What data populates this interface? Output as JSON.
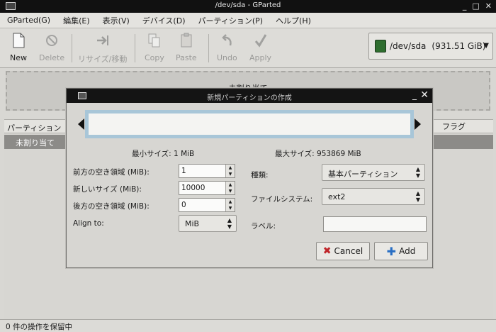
{
  "window": {
    "title": "/dev/sda - GParted",
    "controls": [
      "_",
      "□",
      "✕"
    ]
  },
  "menubar": {
    "items": [
      "GParted(G)",
      "編集(E)",
      "表示(V)",
      "デバイス(D)",
      "パーティション(P)",
      "ヘルプ(H)"
    ]
  },
  "toolbar": {
    "new": "New",
    "delete": "Delete",
    "resize": "リサイズ/移動",
    "copy": "Copy",
    "paste": "Paste",
    "undo": "Undo",
    "apply": "Apply"
  },
  "device": {
    "label": "/dev/sda",
    "size": "(931.51 GiB)"
  },
  "disk_map": {
    "unallocated_label": "未割り当て"
  },
  "partition_list": {
    "headers": {
      "partition": "パーティション",
      "flags": "フラグ"
    },
    "rows": [
      {
        "partition": "未割り当て"
      }
    ]
  },
  "status": {
    "text": "0 件の操作を保留中"
  },
  "dialog": {
    "title": "新規パーティションの作成",
    "min_size": "最小サイズ: 1 MiB",
    "max_size": "最大サイズ: 953869 MiB",
    "free_before_label": "前方の空き領域 (MiB):",
    "free_before_value": "1",
    "new_size_label": "新しいサイズ (MiB):",
    "new_size_value": "10000",
    "free_after_label": "後方の空き領域 (MiB):",
    "free_after_value": "0",
    "align_label": "Align to:",
    "align_value": "MiB",
    "type_label": "種類:",
    "type_value": "基本パーティション",
    "fs_label": "ファイルシステム:",
    "fs_value": "ext2",
    "label_label": "ラベル:",
    "label_value": "",
    "cancel_button": "Cancel",
    "add_button": "Add"
  }
}
